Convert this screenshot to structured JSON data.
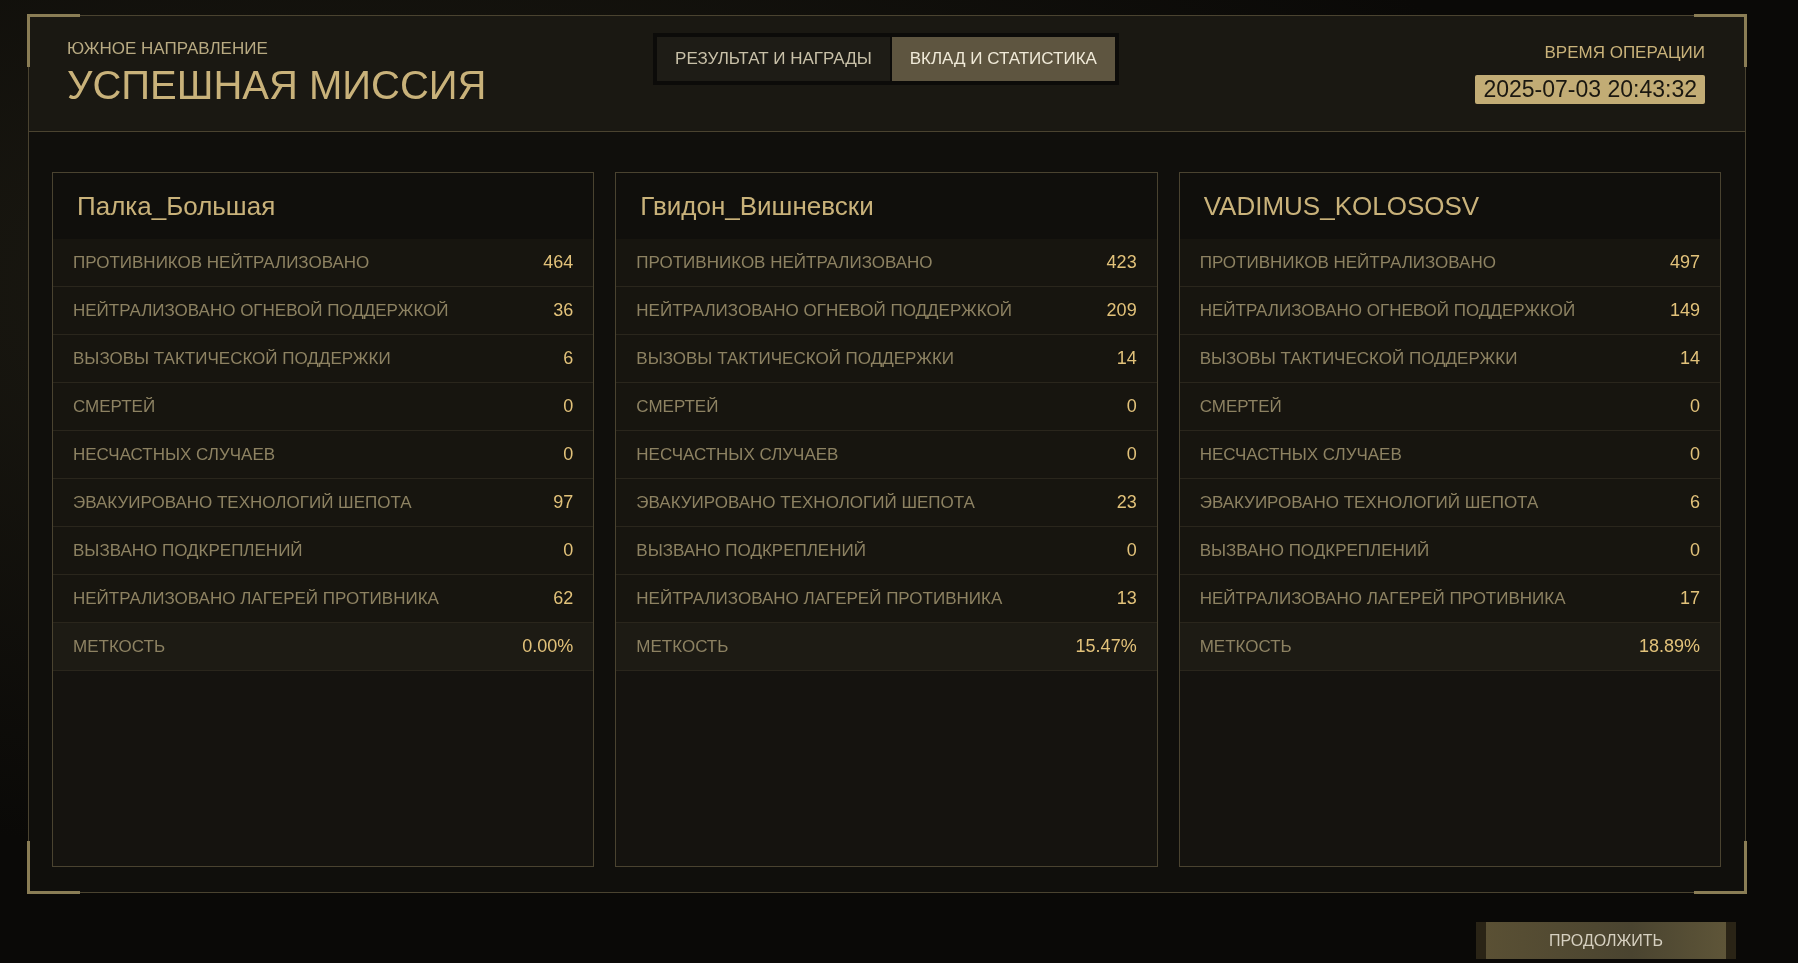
{
  "header": {
    "subtitle": "ЮЖНОЕ НАПРАВЛЕНИЕ",
    "title": "УСПЕШНАЯ МИССИЯ",
    "time_label": "ВРЕМЯ ОПЕРАЦИИ",
    "time_value": "2025-07-03 20:43:32"
  },
  "tabs": [
    {
      "label": "РЕЗУЛЬТАТ И НАГРАДЫ",
      "selected": false
    },
    {
      "label": "ВКЛАД И СТАТИСТИКА",
      "selected": true
    }
  ],
  "players": [
    {
      "name": "Палка_Большая",
      "stats": [
        {
          "label": "ПРОТИВНИКОВ НЕЙТРАЛИЗОВАНО",
          "value": "464"
        },
        {
          "label": "НЕЙТРАЛИЗОВАНО ОГНЕВОЙ ПОДДЕРЖКОЙ",
          "value": "36"
        },
        {
          "label": "ВЫЗОВЫ ТАКТИЧЕСКОЙ ПОДДЕРЖКИ",
          "value": "6"
        },
        {
          "label": "СМЕРТЕЙ",
          "value": "0"
        },
        {
          "label": "НЕСЧАСТНЫХ СЛУЧАЕВ",
          "value": "0"
        },
        {
          "label": "ЭВАКУИРОВАНО ТЕХНОЛОГИЙ ШЕПОТА",
          "value": "97"
        },
        {
          "label": "ВЫЗВАНО ПОДКРЕПЛЕНИЙ",
          "value": "0"
        },
        {
          "label": "НЕЙТРАЛИЗОВАНО ЛАГЕРЕЙ ПРОТИВНИКА",
          "value": "62"
        },
        {
          "label": "МЕТКОСТЬ",
          "value": "0.00%"
        }
      ]
    },
    {
      "name": "Гвидон_Вишневски",
      "stats": [
        {
          "label": "ПРОТИВНИКОВ НЕЙТРАЛИЗОВАНО",
          "value": "423"
        },
        {
          "label": "НЕЙТРАЛИЗОВАНО ОГНЕВОЙ ПОДДЕРЖКОЙ",
          "value": "209"
        },
        {
          "label": "ВЫЗОВЫ ТАКТИЧЕСКОЙ ПОДДЕРЖКИ",
          "value": "14"
        },
        {
          "label": "СМЕРТЕЙ",
          "value": "0"
        },
        {
          "label": "НЕСЧАСТНЫХ СЛУЧАЕВ",
          "value": "0"
        },
        {
          "label": "ЭВАКУИРОВАНО ТЕХНОЛОГИЙ ШЕПОТА",
          "value": "23"
        },
        {
          "label": "ВЫЗВАНО ПОДКРЕПЛЕНИЙ",
          "value": "0"
        },
        {
          "label": "НЕЙТРАЛИЗОВАНО ЛАГЕРЕЙ ПРОТИВНИКА",
          "value": "13"
        },
        {
          "label": "МЕТКОСТЬ",
          "value": "15.47%"
        }
      ]
    },
    {
      "name": "VADIMUS_KOLOSOSV",
      "stats": [
        {
          "label": "ПРОТИВНИКОВ НЕЙТРАЛИЗОВАНО",
          "value": "497"
        },
        {
          "label": "НЕЙТРАЛИЗОВАНО ОГНЕВОЙ ПОДДЕРЖКОЙ",
          "value": "149"
        },
        {
          "label": "ВЫЗОВЫ ТАКТИЧЕСКОЙ ПОДДЕРЖКИ",
          "value": "14"
        },
        {
          "label": "СМЕРТЕЙ",
          "value": "0"
        },
        {
          "label": "НЕСЧАСТНЫХ СЛУЧАЕВ",
          "value": "0"
        },
        {
          "label": "ЭВАКУИРОВАНО ТЕХНОЛОГИЙ ШЕПОТА",
          "value": "6"
        },
        {
          "label": "ВЫЗВАНО ПОДКРЕПЛЕНИЙ",
          "value": "0"
        },
        {
          "label": "НЕЙТРАЛИЗОВАНО ЛАГЕРЕЙ ПРОТИВНИКА",
          "value": "17"
        },
        {
          "label": "МЕТКОСТЬ",
          "value": "18.89%"
        }
      ]
    }
  ],
  "continue_button": "ПРОДОЛЖИТЬ"
}
